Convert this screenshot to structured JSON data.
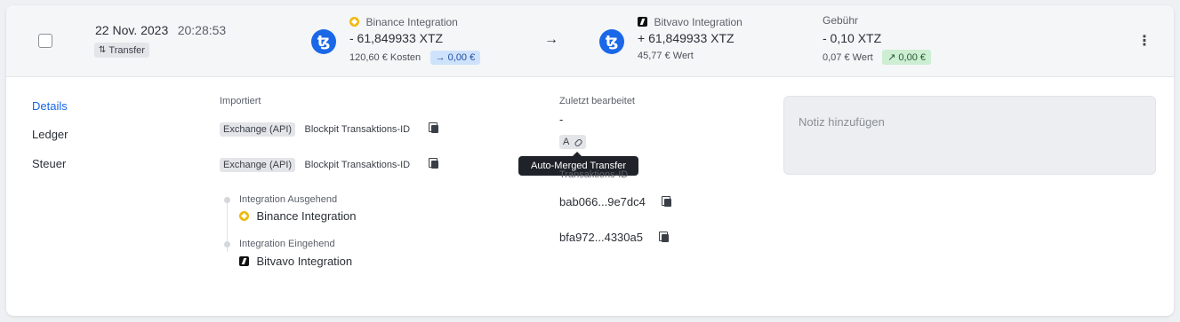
{
  "transaction": {
    "date": "22 Nov. 2023",
    "time": "20:28:53",
    "type_tag": "Transfer",
    "outgoing": {
      "integration": "Binance Integration",
      "amount": "- 61,849933 XTZ",
      "cost": "120,60 € Kosten",
      "change": "0,00 €"
    },
    "incoming": {
      "integration": "Bitvavo Integration",
      "amount": "+ 61,849933 XTZ",
      "value": "45,77 € Wert"
    },
    "fee": {
      "label": "Gebühr",
      "amount": "- 0,10 XTZ",
      "value": "0,07 € Wert",
      "change": "0,00 €"
    }
  },
  "nav": {
    "items": [
      "Details",
      "Ledger",
      "Steuer"
    ],
    "active": "Details"
  },
  "details": {
    "imported_label": "Importiert",
    "imports": [
      {
        "badge": "Exchange (API)",
        "label": "Blockpit Transaktions-ID"
      },
      {
        "badge": "Exchange (API)",
        "label": "Blockpit Transaktions-ID"
      }
    ],
    "timeline": [
      {
        "label": "Integration Ausgehend",
        "name": "Binance Integration"
      },
      {
        "label": "Integration Eingehend",
        "name": "Bitvavo Integration"
      }
    ],
    "last_edited_label": "Zuletzt bearbeitet",
    "last_edited_value": "-",
    "auto_badge": "A",
    "tooltip": "Auto-Merged Transfer",
    "tx_id_label": "Transaktions-ID",
    "tx_ids": [
      "bab066...9e7dc4",
      "bfa972...4330a5"
    ],
    "note_placeholder": "Notiz hinzufügen"
  },
  "icons": {
    "tezos": "tezos-icon",
    "binance": "binance-icon",
    "bitvavo": "bitvavo-icon",
    "copy": "copy-icon",
    "link": "link-icon",
    "kebab": "more-vertical-icon"
  },
  "colors": {
    "accent": "#1a67e8",
    "binance": "#f0b90b",
    "pill_blue": "#cfe2fb",
    "pill_green": "#cdeed3"
  }
}
